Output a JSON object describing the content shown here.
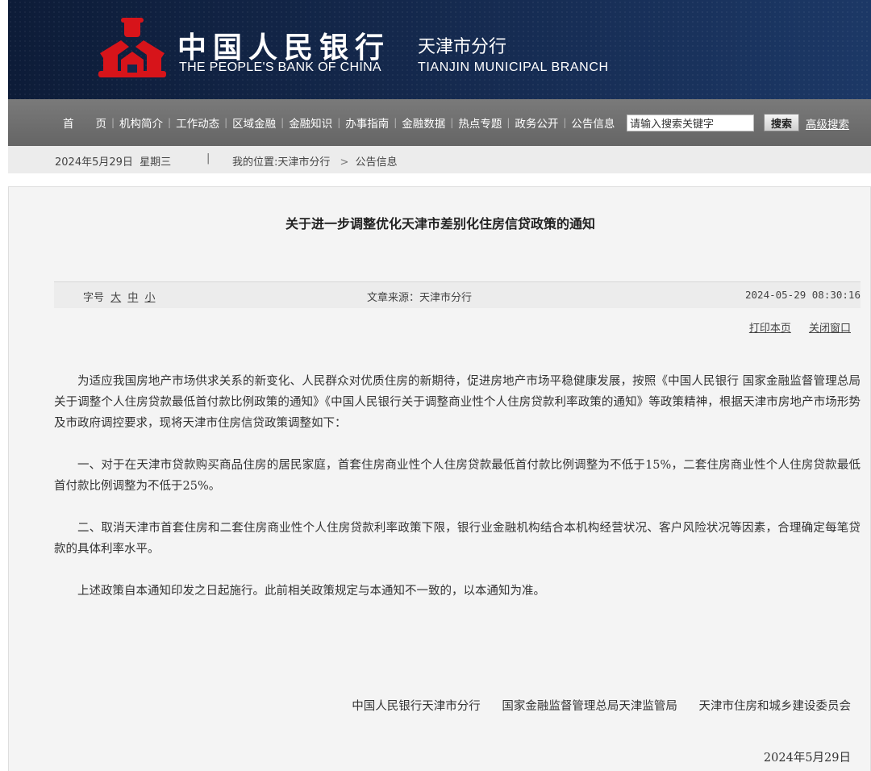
{
  "header": {
    "cn_title": "中国人民银行",
    "cn_branch": "天津市分行",
    "en_title": "THE PEOPLE'S BANK OF CHINA",
    "en_branch": "TIANJIN MUNICIPAL BRANCH",
    "brand_color": "#d7141a"
  },
  "nav": {
    "items": [
      "首　　页",
      "机构简介",
      "工作动态",
      "区域金融",
      "金融知识",
      "办事指南",
      "金融数据",
      "热点专题",
      "政务公开",
      "公告信息"
    ],
    "search_placeholder": "请输入搜索关键字",
    "search_button": "搜索",
    "advanced_search": "高级搜索"
  },
  "breadcrumb": {
    "date": "2024年5月29日  星期三",
    "separator": "|",
    "prefix": "我的位置:",
    "location": "天津市分行",
    "current": "公告信息"
  },
  "article": {
    "title": "关于进一步调整优化天津市差别化住房信贷政策的通知",
    "font_size_label": "字号",
    "font_sizes": [
      "大",
      "中",
      "小"
    ],
    "source": "文章来源：天津市分行",
    "pub_time": "2024-05-29 08:30:16",
    "print_label": "打印本页",
    "close_label": "关闭窗口",
    "paragraphs": [
      "为适应我国房地产市场供求关系的新变化、人民群众对优质住房的新期待，促进房地产市场平稳健康发展，按照《中国人民银行 国家金融监督管理总局关于调整个人住房贷款最低首付款比例政策的通知》《中国人民银行关于调整商业性个人住房贷款利率政策的通知》等政策精神，根据天津市房地产市场形势及市政府调控要求，现将天津市住房信贷政策调整如下：",
      "一、对于在天津市贷款购买商品住房的居民家庭，首套住房商业性个人住房贷款最低首付款比例调整为不低于15%，二套住房商业性个人住房贷款最低首付款比例调整为不低于25%。",
      "二、取消天津市首套住房和二套住房商业性个人住房贷款利率政策下限，银行业金融机构结合本机构经营状况、客户风险状况等因素，合理确定每笔贷款的具体利率水平。",
      "上述政策自本通知印发之日起施行。此前相关政策规定与本通知不一致的，以本通知为准。"
    ],
    "signers": [
      "中国人民银行天津市分行",
      "国家金融监督管理总局天津监管局",
      "天津市住房和城乡建设委员会"
    ],
    "sign_date": "2024年5月29日"
  }
}
